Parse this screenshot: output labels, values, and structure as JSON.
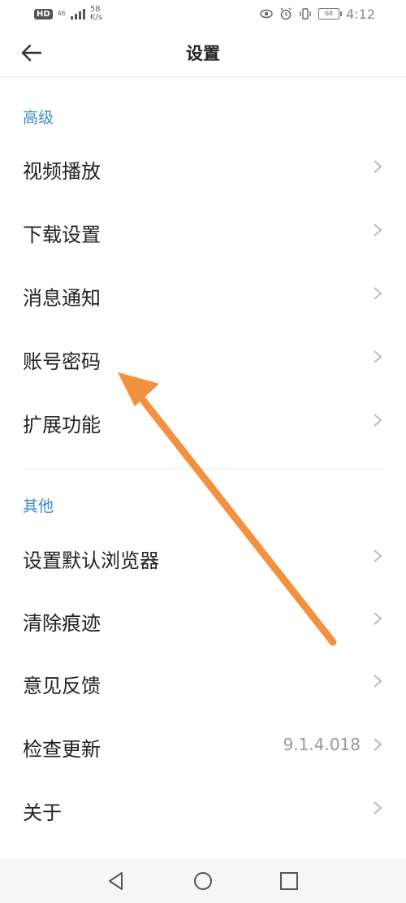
{
  "status_bar": {
    "hd_badge": "HD",
    "network_type": "4G",
    "network_sub": "46",
    "speed_value": "58",
    "speed_unit": "K/s",
    "battery": "68",
    "time": "4:12"
  },
  "header": {
    "title": "设置"
  },
  "sections": [
    {
      "label": "高级",
      "items": [
        {
          "label": "视频播放"
        },
        {
          "label": "下载设置"
        },
        {
          "label": "消息通知"
        },
        {
          "label": "账号密码"
        },
        {
          "label": "扩展功能"
        }
      ]
    },
    {
      "label": "其他",
      "items": [
        {
          "label": "设置默认浏览器"
        },
        {
          "label": "清除痕迹"
        },
        {
          "label": "意见反馈"
        },
        {
          "label": "检查更新",
          "value": "9.1.4.018"
        },
        {
          "label": "关于"
        }
      ]
    }
  ],
  "colors": {
    "accent": "#3d8ac9",
    "annotation_arrow": "#f4913f"
  }
}
